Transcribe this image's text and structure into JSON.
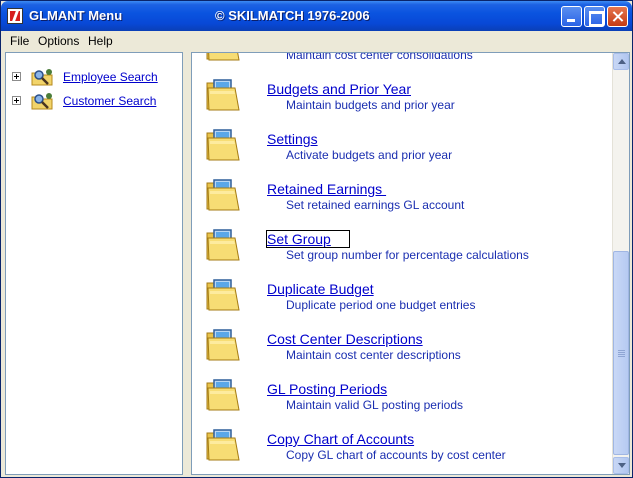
{
  "window": {
    "title": "GLMANT Menu",
    "copyright": "© SKILMATCH 1976-2006"
  },
  "menu": {
    "file": "File",
    "options": "Options",
    "help": "Help"
  },
  "tree": {
    "items": [
      {
        "label": "Employee Search",
        "icon": "search-icon"
      },
      {
        "label": "Customer Search",
        "icon": "search-icon"
      }
    ]
  },
  "entries": [
    {
      "title": "",
      "desc": "Maintain cost center consolidations"
    },
    {
      "title": "Budgets and Prior Year",
      "desc": "Maintain budgets and prior year"
    },
    {
      "title": "Settings",
      "desc": "Activate budgets and prior year"
    },
    {
      "title": "Retained Earnings ",
      "desc": "Set retained earnings GL account"
    },
    {
      "title": "Set Group",
      "desc": "Set group number for percentage calculations"
    },
    {
      "title": "Duplicate Budget",
      "desc": "Duplicate period one budget entries"
    },
    {
      "title": "Cost Center Descriptions",
      "desc": "Maintain cost center descriptions"
    },
    {
      "title": "GL Posting Periods",
      "desc": "Maintain valid GL posting periods"
    },
    {
      "title": "Copy Chart of Accounts",
      "desc": "Copy GL chart of accounts by cost center"
    }
  ],
  "colors": {
    "link": "#0000cc",
    "description": "#1a2eb0",
    "titlebar": "#0a54e0"
  }
}
